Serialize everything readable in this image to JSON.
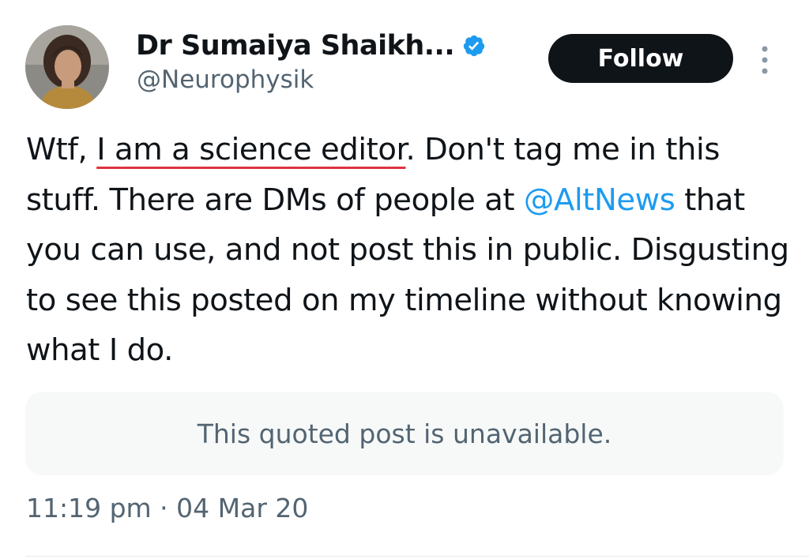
{
  "author": {
    "display_name": "Dr Sumaiya Shaikh...",
    "handle": "@Neurophysik",
    "verified": true
  },
  "actions": {
    "follow_label": "Follow"
  },
  "tweet": {
    "text_part1": "Wtf, ",
    "text_underlined": "I am a science editor",
    "text_part2": ". Don't tag me in this stuff. There are DMs of people at ",
    "mention": "@AltNews",
    "text_part3": " that you can use, and not post this in public. Disgusting to see this posted on my timeline without knowing what I do."
  },
  "quoted_post": {
    "message": "This quoted post is unavailable."
  },
  "meta": {
    "timestamp": "11:19 pm · 04 Mar 20"
  },
  "colors": {
    "text": "#0f1419",
    "secondary": "#536471",
    "accent": "#1d9bf0",
    "underline_annotation": "#e0323f",
    "button_bg": "#0f1419"
  },
  "icons": {
    "verified": "verified-badge-icon",
    "more": "more-options-icon"
  }
}
